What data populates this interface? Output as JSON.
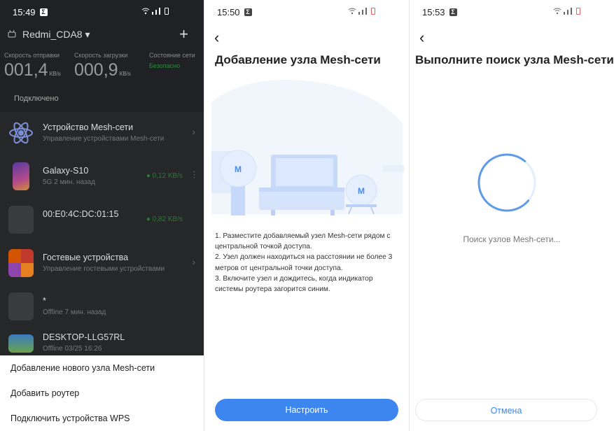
{
  "s1": {
    "time": "15:49",
    "router_name": "Redmi_CDA8 ▾",
    "stats": [
      {
        "label": "Скорость отправки",
        "value": "001,4",
        "unit": "КB/s"
      },
      {
        "label": "Скорость загрузки",
        "value": "000,9",
        "unit": "КB/s"
      },
      {
        "label": "Состояние сети",
        "status": "Безопасно"
      }
    ],
    "connected_label": "Подключено",
    "devices": [
      {
        "title": "Устройство Mesh-сети",
        "sub": "Управление устройствами Mesh-сети",
        "speed": ""
      },
      {
        "title": "Galaxy-S10",
        "sub": "5G   2 мин. назад",
        "speed": "● 0,12 KB/s"
      },
      {
        "title": "00:E0:4C:DC:01:15",
        "sub": "",
        "speed": "● 0,82 KB/s"
      },
      {
        "title": "Гостевые устройства",
        "sub": "Управление гостевыми устройствами",
        "speed": ""
      },
      {
        "title": "*",
        "sub": "Offline   7 мин. назад",
        "speed": ""
      },
      {
        "title": "DESKTOP-LLG57RL",
        "sub": "Offline   03/25 16:26",
        "speed": ""
      }
    ],
    "sheet": [
      "Добавление нового узла Mesh-сети",
      "Добавить роутер",
      "Подключить устройства WPS"
    ]
  },
  "s2": {
    "time": "15:50",
    "title": "Добавление узла Mesh-сети",
    "steps": [
      "1. Разместите добавляемый узел Mesh-сети рядом с центральной точкой доступа.",
      "2. Узел должен находиться на расстоянии не более 3 метров от центральной точки доступа.",
      "3. Включите узел и дождитесь, когда индикатор системы роутера загорится синим."
    ],
    "button": "Настроить"
  },
  "s3": {
    "time": "15:53",
    "title": "Выполните поиск узла Mesh-сети,",
    "searching": "Поиск узлов Mesh-сети...",
    "cancel": "Отмена"
  },
  "colors": {
    "accent": "#3d86f0",
    "dark_bg": "#1f2125",
    "safe_green": "#2e8a3a"
  },
  "icons": [
    "back-arrow-icon",
    "plus-icon",
    "wifi-icon",
    "signal-icon",
    "battery-icon",
    "chevron-right-icon",
    "mesh-atom-icon"
  ]
}
